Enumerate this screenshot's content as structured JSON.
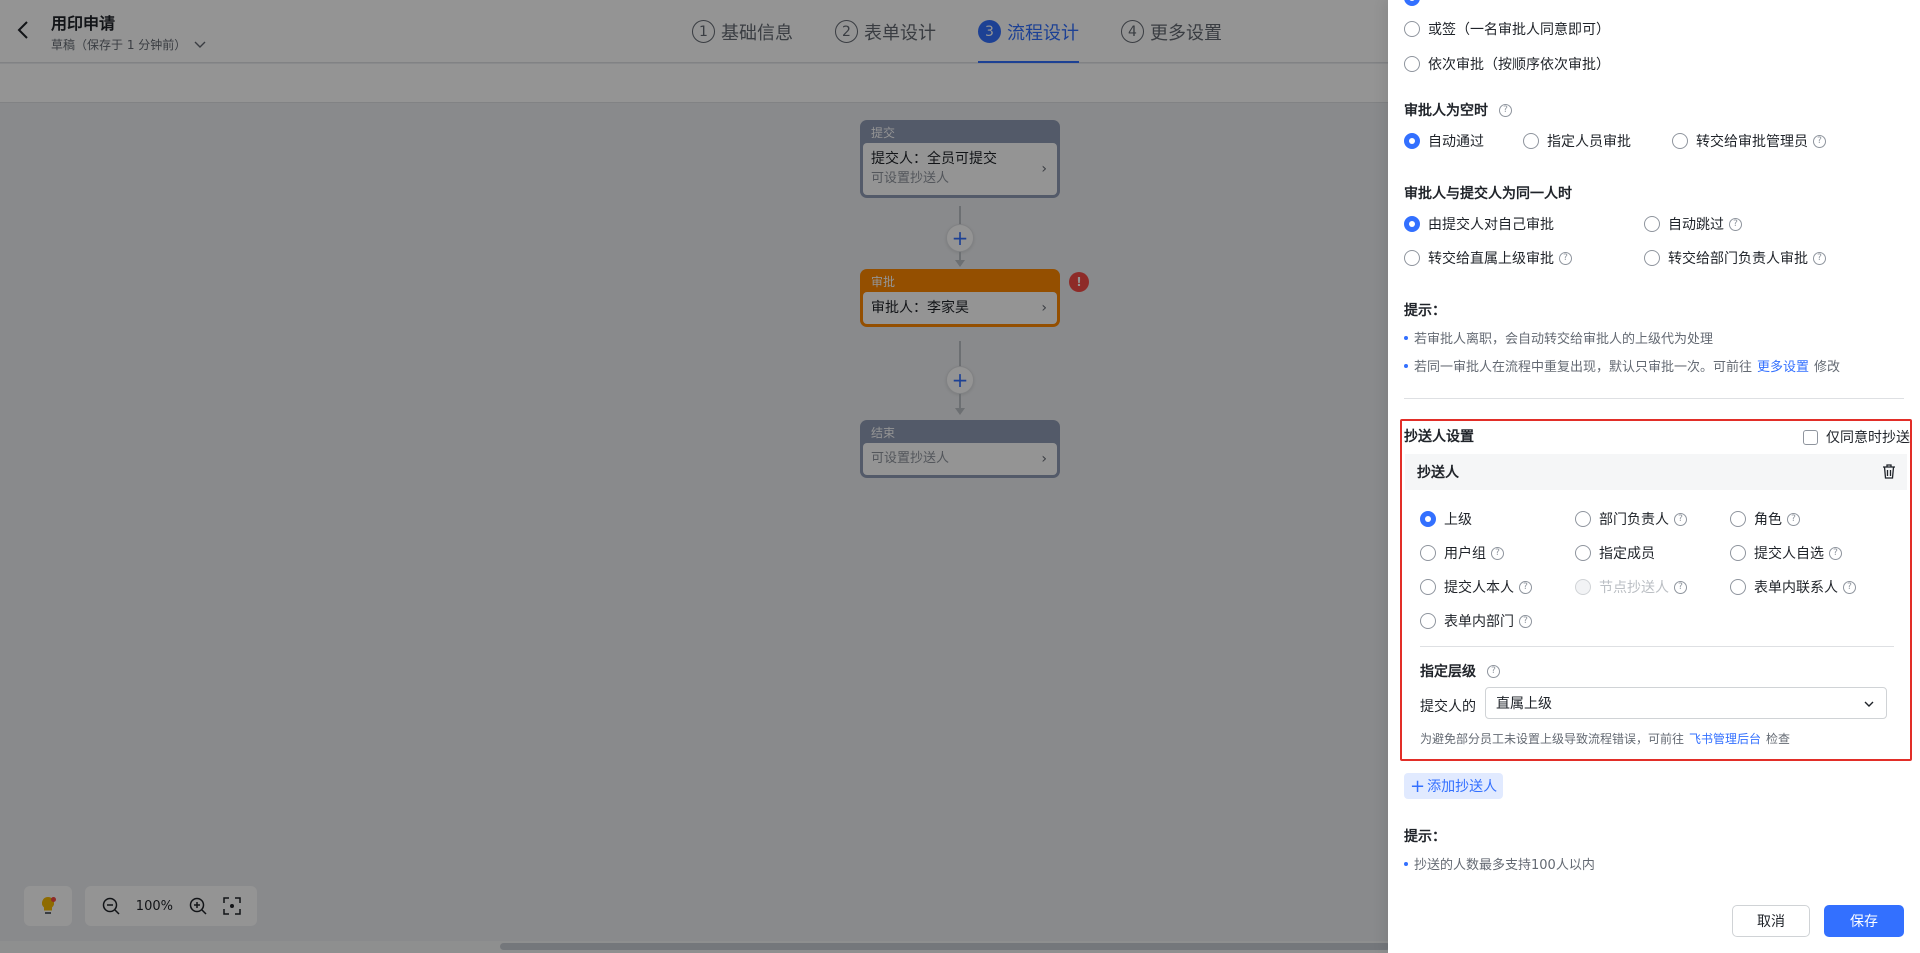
{
  "header": {
    "title": "用印申请",
    "draft_status": "草稿（保存于 1 分钟前）",
    "steps": [
      {
        "num": "1",
        "label": "基础信息"
      },
      {
        "num": "2",
        "label": "表单设计"
      },
      {
        "num": "3",
        "label": "流程设计"
      },
      {
        "num": "4",
        "label": "更多设置"
      }
    ],
    "active_step": 3
  },
  "flow": {
    "submit": {
      "header": "提交",
      "line1": "提交人：全员可提交",
      "line2": "可设置抄送人"
    },
    "approve": {
      "header": "审批",
      "line1": "审批人：李家昊"
    },
    "end": {
      "header": "结束",
      "line1": "可设置抄送人"
    },
    "error_mark": "!",
    "add_symbol": "+"
  },
  "toolbar": {
    "zoom": "100%"
  },
  "panel": {
    "top_options": {
      "or_sign": "或签（一名审批人同意即可）",
      "sequential": "依次审批（按顺序依次审批）"
    },
    "empty_approver": {
      "title": "审批人为空时",
      "options": [
        "自动通过",
        "指定人员审批",
        "转交给审批管理员"
      ],
      "selected": "自动通过"
    },
    "same_person": {
      "title": "审批人与提交人为同一人时",
      "options": [
        "由提交人对自己审批",
        "自动跳过",
        "转交给直属上级审批",
        "转交给部门负责人审批"
      ],
      "selected": "由提交人对自己审批"
    },
    "tips1": {
      "title": "提示：",
      "items": [
        "若审批人离职，会自动转交给审批人的上级代为处理",
        "若同一审批人在流程中重复出现，默认只审批一次。可前往"
      ],
      "link": "更多设置",
      "suffix": "修改"
    },
    "cc": {
      "title": "抄送人设置",
      "only_agree_label": "仅同意时抄送",
      "only_agree_checked": false,
      "card_title": "抄送人",
      "options": [
        "上级",
        "部门负责人",
        "角色",
        "用户组",
        "指定成员",
        "提交人自选",
        "提交人本人",
        "节点抄送人",
        "表单内联系人",
        "表单内部门"
      ],
      "selected": "上级",
      "disabled": [
        "节点抄送人"
      ],
      "level_title": "指定层级",
      "level_prefix": "提交人的",
      "level_value": "直属上级",
      "hint_prefix": "为避免部分员工未设置上级导致流程错误，可前往",
      "hint_link": "飞书管理后台",
      "hint_suffix": "检查"
    },
    "add_cc": "添加抄送人",
    "tips2": {
      "title": "提示：",
      "items": [
        "抄送的人数最多支持100人以内"
      ]
    },
    "buttons": {
      "cancel": "取消",
      "save": "保存"
    }
  },
  "colors": {
    "accent": "#3370ff",
    "approve_node": "#ff8800",
    "highlight_box": "#e22e28"
  }
}
